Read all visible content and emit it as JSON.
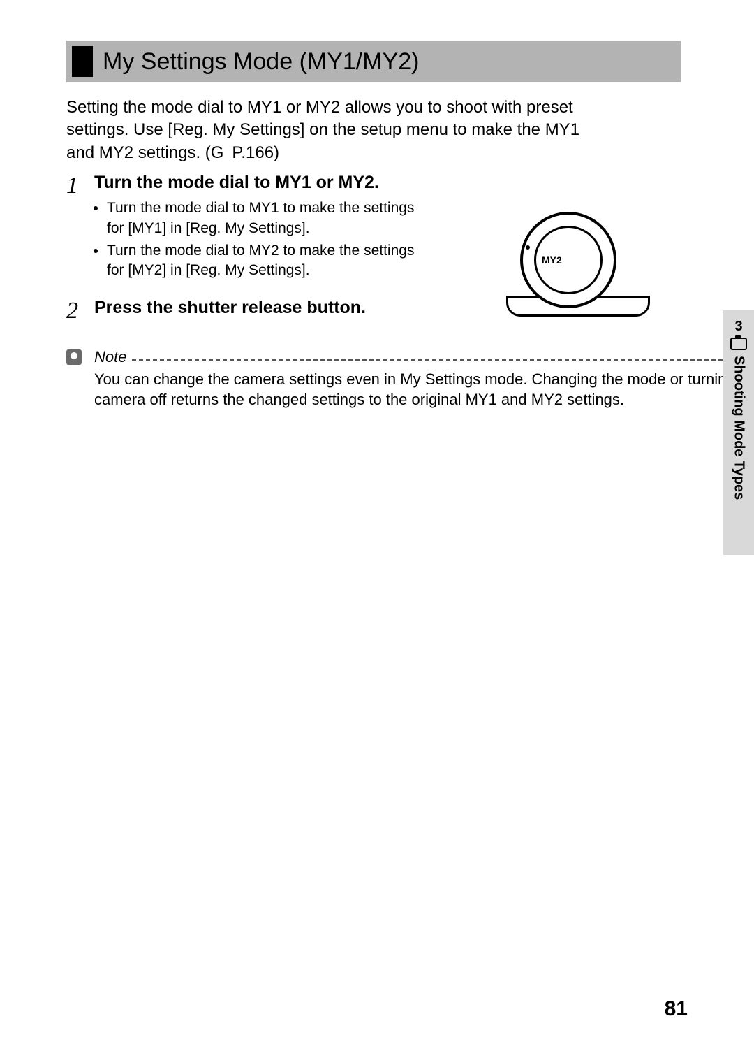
{
  "heading": "My Settings Mode (MY1/MY2)",
  "intro": "Setting the mode dial to MY1 or MY2 allows you to shoot with preset settings. Use [Reg. My Settings] on the setup menu to make the MY1 and MY2 settings. (G P.166)",
  "steps": [
    {
      "num": "1",
      "head": "Turn the mode dial to MY1 or MY2.",
      "bullets": [
        "Turn the mode dial to MY1 to make the settings for [MY1] in [Reg. My Settings].",
        "Turn the mode dial to MY2 to make the settings for [MY2] in [Reg. My Settings]."
      ]
    },
    {
      "num": "2",
      "head": "Press the shutter release button.",
      "bullets": []
    }
  ],
  "dial_label": "MY2",
  "note": {
    "label": "Note",
    "body": "You can change the camera settings even in My Settings mode. Changing the mode or turning the camera off returns the changed settings to the original MY1 and MY2 settings."
  },
  "side_tab": {
    "num": "3",
    "text": "Shooting Mode Types"
  },
  "page_number": "81"
}
